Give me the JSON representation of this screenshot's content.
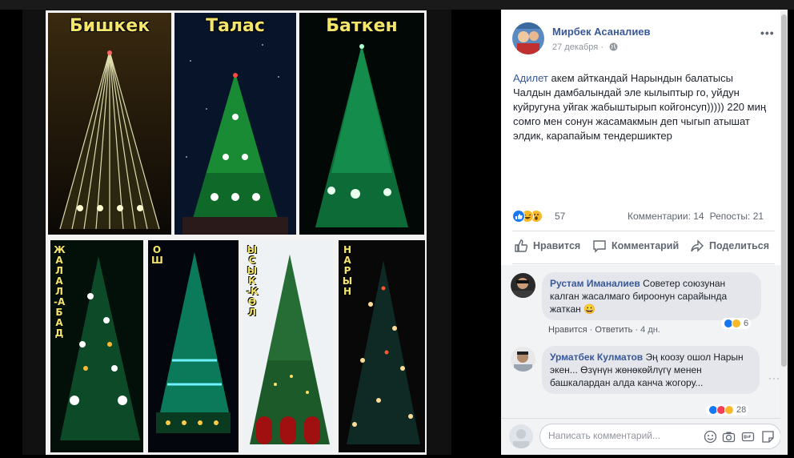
{
  "post": {
    "author": "Мирбек Асаналиев",
    "date": "27 декабря",
    "text_mention": "Адилет",
    "text_body": " акем айткандай Нарындын балатысы Чалдын дамбалындай эле кылыптыр го, уйдун куйругуна уйгак жабыштырып койгонсуп))))) 220 миң сомго мен сонун жасамакмын деп чыгып атышат элдик, карапайым тендершиктер",
    "reaction_count": "57",
    "comments_stat": "Комментарии: 14",
    "shares_stat": "Репосты: 21"
  },
  "photo": {
    "cities": [
      "Бишкек",
      "Талас",
      "Баткен",
      "ЖАЛАЛ-АБАД",
      "ОШ",
      "ЫСЫК-КӨЛ",
      "НАРЫН"
    ]
  },
  "actions": {
    "like": "Нравится",
    "comment": "Комментарий",
    "share": "Поделиться"
  },
  "comments": [
    {
      "author": "Рустам Иманалиев",
      "text": " Советер союзунан калган жасалмаго бироонун сарайында жаткан 😀",
      "like": "Нравится",
      "reply": "Ответить",
      "time": "4 дн.",
      "reactions": "6"
    },
    {
      "author": "Урматбек Кулматов",
      "text": " Эң коозу ошол Нарын экен... Өзүнүн жөнөкөйлүгү менен башкалардан алда канча жогору...",
      "reactions": "28"
    }
  ],
  "composer": {
    "placeholder": "Написать комментарий..."
  },
  "colors": {
    "link": "#385898",
    "like_blue": "#1877f2",
    "haha_yellow": "#f7b928",
    "love_red": "#f33e58"
  }
}
